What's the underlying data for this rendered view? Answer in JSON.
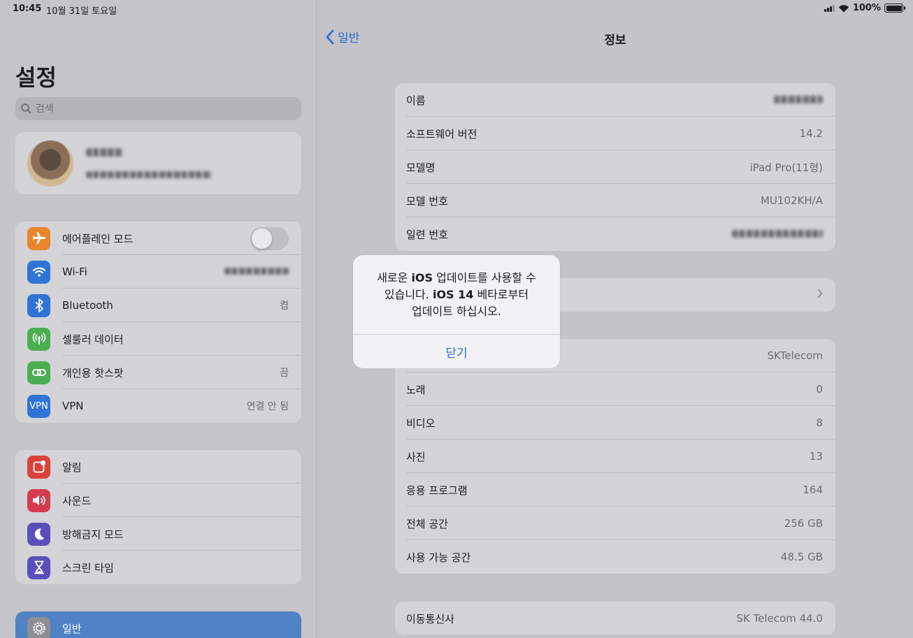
{
  "status": {
    "time": "10:45",
    "date": "10월 31일 토요일",
    "battery": "100%"
  },
  "sidebar": {
    "title": "설정",
    "search_placeholder": "검색",
    "group1": [
      {
        "label": "에어플레인 모드",
        "value": "",
        "icon": "airplane-icon",
        "color": "#e8862c",
        "toggle": false
      },
      {
        "label": "Wi-Fi",
        "value": "",
        "icon": "wifi-icon",
        "color": "#2f74d6"
      },
      {
        "label": "Bluetooth",
        "value": "켬",
        "icon": "bluetooth-icon",
        "color": "#2f74d6"
      },
      {
        "label": "셀룰러 데이터",
        "value": "",
        "icon": "cellular-icon",
        "color": "#4cae53"
      },
      {
        "label": "개인용 핫스팟",
        "value": "끔",
        "icon": "hotspot-icon",
        "color": "#4cae53"
      },
      {
        "label": "VPN",
        "value": "연결 안 됨",
        "icon": "vpn-icon",
        "color": "#2f74d6",
        "icon_text": "VPN"
      }
    ],
    "group2": [
      {
        "label": "알림",
        "icon": "notifications-icon",
        "color": "#d9423a"
      },
      {
        "label": "사운드",
        "icon": "sound-icon",
        "color": "#d53b4f"
      },
      {
        "label": "방해금지 모드",
        "icon": "moon-icon",
        "color": "#5a4fb8"
      },
      {
        "label": "스크린 타임",
        "icon": "hourglass-icon",
        "color": "#5a4fb8"
      }
    ],
    "group3": [
      {
        "label": "일반",
        "icon": "gear-icon",
        "color": "#8e8e93"
      }
    ]
  },
  "detail": {
    "back_label": "일반",
    "title": "정보",
    "card1": [
      {
        "label": "이름",
        "value": ""
      },
      {
        "label": "소프트웨어 버전",
        "value": "14.2"
      },
      {
        "label": "모델명",
        "value": "iPad Pro(11형)"
      },
      {
        "label": "모델 번호",
        "value": "MU102KH/A"
      },
      {
        "label": "일련 번호",
        "value": ""
      }
    ],
    "card3": [
      {
        "label": "",
        "value": "SKTelecom"
      },
      {
        "label": "노래",
        "value": "0"
      },
      {
        "label": "비디오",
        "value": "8"
      },
      {
        "label": "사진",
        "value": "13"
      },
      {
        "label": "응용 프로그램",
        "value": "164"
      },
      {
        "label": "전체 공간",
        "value": "256 GB"
      },
      {
        "label": "사용 가능 공간",
        "value": "48.5 GB"
      }
    ],
    "card4": [
      {
        "label": "이동통신사",
        "value": "SK Telecom 44.0"
      }
    ]
  },
  "alert": {
    "line1_a": "새로운 ",
    "line1_b": "iOS",
    "line1_c": " 업데이트를 사용할 수",
    "line2_a": "있습니다. ",
    "line2_b": "iOS 14",
    "line2_c": " 베타로부터",
    "line3": "업데이트 하십시오.",
    "button": "닫기"
  }
}
